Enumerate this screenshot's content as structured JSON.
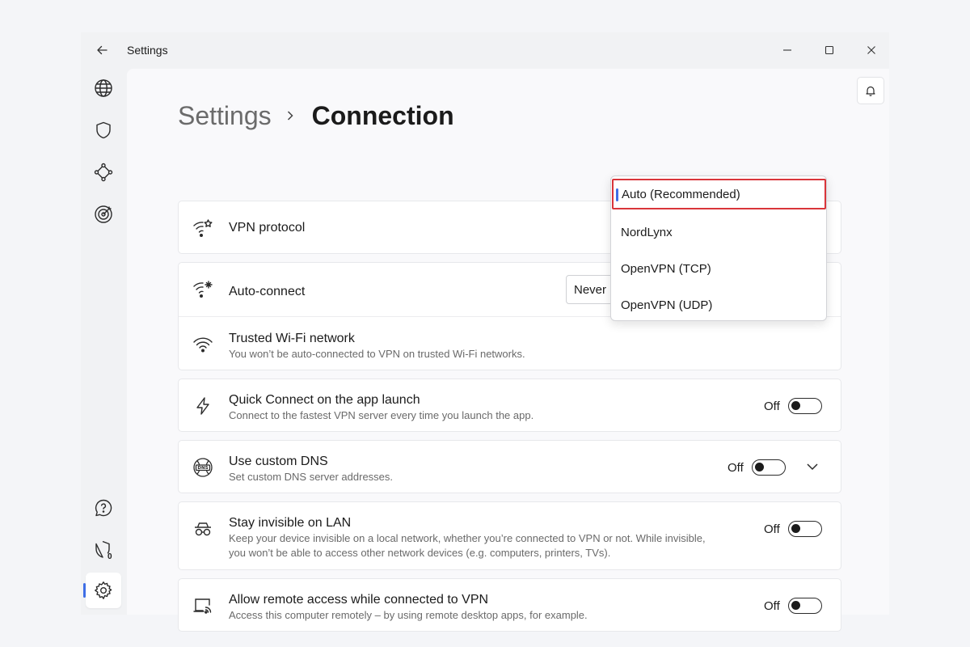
{
  "window": {
    "title": "Settings"
  },
  "breadcrumb": {
    "parent": "Settings",
    "current": "Connection"
  },
  "sidebar": {
    "items": [
      {
        "icon": "globe-icon"
      },
      {
        "icon": "shield-icon"
      },
      {
        "icon": "meshnet-icon"
      },
      {
        "icon": "target-icon"
      },
      {
        "icon": "help-chat-icon"
      },
      {
        "icon": "threat-protection-icon",
        "badge": "0"
      },
      {
        "icon": "gear-icon",
        "active": true
      }
    ]
  },
  "settings": {
    "vpn_protocol": {
      "title": "VPN protocol",
      "icon": "wifi-star-icon"
    },
    "auto_connect": {
      "title": "Auto-connect",
      "icon": "wifi-sparkle-icon",
      "value": "Never"
    },
    "trusted_wifi": {
      "title": "Trusted Wi-Fi network",
      "description": "You won’t be auto-connected to VPN on trusted Wi-Fi networks.",
      "icon": "wifi-icon"
    },
    "quick_connect": {
      "title": "Quick Connect on the app launch",
      "description": "Connect to the fastest VPN server every time you launch the app.",
      "icon": "lightning-icon",
      "state": "Off"
    },
    "custom_dns": {
      "title": "Use custom DNS",
      "description": "Set custom DNS server addresses.",
      "icon": "dns-globe-icon",
      "state": "Off"
    },
    "invisible_lan": {
      "title": "Stay invisible on LAN",
      "description_line1": "Keep your device invisible on a local network, whether you’re connected to VPN or not. While invisible,",
      "description_line2": "you won’t be able to access other network devices (e.g. computers, printers, TVs).",
      "icon": "incognito-icon",
      "state": "Off"
    },
    "remote_access": {
      "title": "Allow remote access while connected to VPN",
      "description": "Access this computer remotely – by using remote desktop apps, for example.",
      "icon": "remote-desktop-icon",
      "state": "Off"
    }
  },
  "protocol_dropdown": {
    "selected": "Auto (Recommended)",
    "options": [
      "Auto (Recommended)",
      "NordLynx",
      "OpenVPN (TCP)",
      "OpenVPN (UDP)"
    ]
  },
  "colors": {
    "accent": "#3e6ee6",
    "highlight_border": "#d9353a"
  }
}
